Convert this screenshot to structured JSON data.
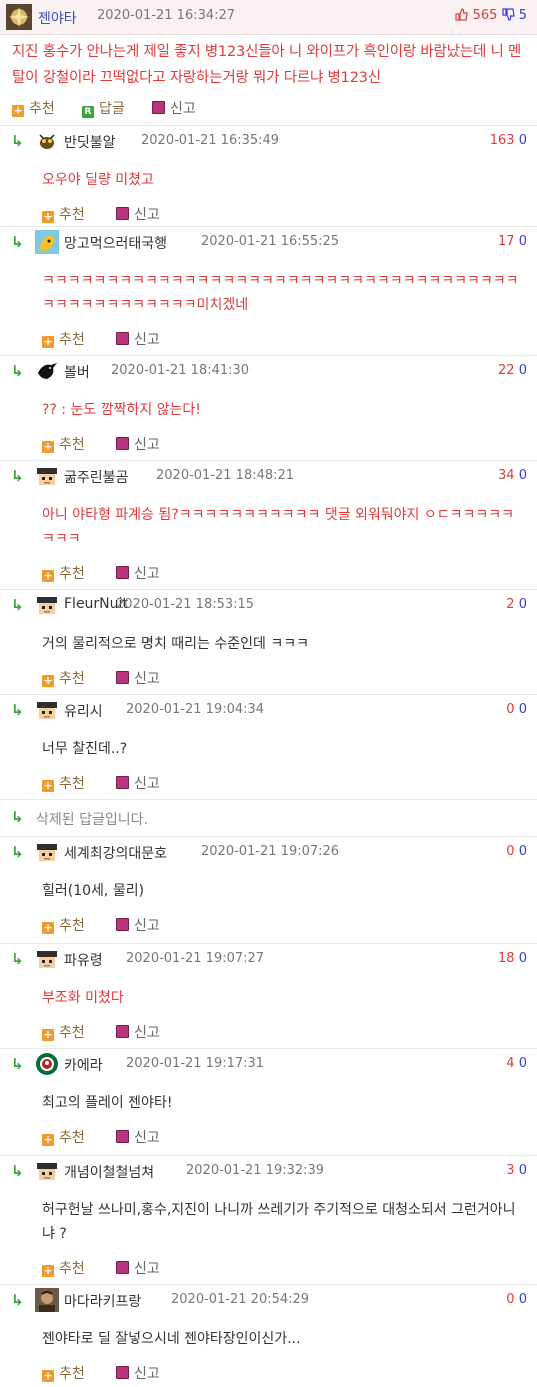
{
  "post": {
    "author": "젠야타",
    "date": "2020-01-21 16:34:27",
    "upvotes": "565",
    "downvotes": "5",
    "body": "지진 홍수가 안나는게 제일 좋지 병123신들아 니 와이프가 흑인이랑 바람났는데 니 멘탈이 강철이라 끄떡없다고 자랑하는거랑 뭐가 다르냐 병123신",
    "actions": {
      "recommend": "추천",
      "reply": "답글",
      "report": "신고"
    }
  },
  "reply_badge": "R",
  "comment_actions": {
    "recommend": "추천",
    "report": "신고"
  },
  "comments": [
    {
      "name": "반딧불알",
      "date": "2020-01-21 16:35:49",
      "up": "163",
      "down": "0",
      "text": "오우야 딜량 미쳤고",
      "avatar": "bug-icon"
    },
    {
      "name": "망고먹으러태국행",
      "date": "2020-01-21 16:55:25",
      "up": "17",
      "down": "0",
      "text": "ㅋㅋㅋㅋㅋㅋㅋㅋㅋㅋㅋㅋㅋㅋㅋㅋㅋㅋㅋㅋㅋㅋㅋㅋㅋㅋㅋㅋㅋㅋㅋㅋㅋㅋㅋㅋㅋㅋㅋㅋㅋㅋㅋㅋㅋㅋㅋㅋㅋ미치겠네",
      "avatar": "mango-icon"
    },
    {
      "name": "볼버",
      "date": "2020-01-21 18:41:30",
      "up": "22",
      "down": "0",
      "text": "?? : 눈도 깜짝하지 않는다!",
      "avatar": "crow-icon"
    },
    {
      "name": "굶주린불곰",
      "date": "2020-01-21 18:48:21",
      "up": "34",
      "down": "0",
      "text": "아니 야타형 파계승 됨?ㅋㅋㅋㅋㅋㅋㅋㅋㅋㅋㅋ 댓글 외워둬야지 ㅇㄷㅋㅋㅋㅋㅋㅋㅋㅋ",
      "avatar": "pixel-face-icon"
    },
    {
      "name": "FleurNuit",
      "date": "2020-01-21 18:53:15",
      "up": "2",
      "down": "0",
      "text": "거의 물리적으로 명치 때리는 수준인데 ㅋㅋㅋ",
      "avatar": "pixel-face-icon"
    },
    {
      "name": "유리시",
      "date": "2020-01-21 19:04:34",
      "up": "0",
      "down": "0",
      "text": "너무 찰진데..?",
      "avatar": "pixel-face-icon"
    },
    {
      "deleted": "삭제된 답글입니다."
    },
    {
      "name": "세계최강의대문호",
      "date": "2020-01-21 19:07:26",
      "up": "0",
      "down": "0",
      "text": "힐러(10세, 물리)",
      "avatar": "pixel-face-icon"
    },
    {
      "name": "파유령",
      "date": "2020-01-21 19:07:27",
      "up": "18",
      "down": "0",
      "text": "부조화 미쳤다",
      "avatar": "pixel-face-icon"
    },
    {
      "name": "카에라",
      "date": "2020-01-21 19:17:31",
      "up": "4",
      "down": "0",
      "text": "최고의 플레이 젠야타!",
      "avatar": "starbucks-icon"
    },
    {
      "name": "개념이철철넘쳐",
      "date": "2020-01-21 19:32:39",
      "up": "3",
      "down": "0",
      "text": "허구헌날 쓰나미,홍수,지진이 나니까 쓰레기가 주기적으로 대청소되서 그런거아니냐 ?",
      "avatar": "pixel-face-icon"
    },
    {
      "name": "마다라키프랑",
      "date": "2020-01-21 20:54:29",
      "up": "0",
      "down": "0",
      "text": "젠야타로 딜 잘넣으시네 젠야타장인이신가...",
      "avatar": "man-photo-icon"
    }
  ],
  "colors": {
    "accent_red": "#e03b3b",
    "accent_blue": "#3b3bd6",
    "reply_green": "#3ca53c",
    "header_bg": "#faf2f2"
  }
}
